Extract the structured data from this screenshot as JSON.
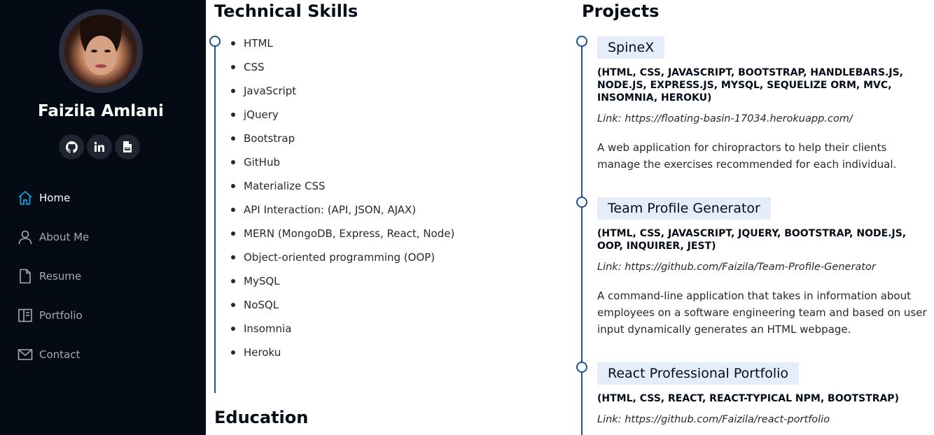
{
  "profile": {
    "name": "Faizila Amlani",
    "social": [
      {
        "icon": "github-icon"
      },
      {
        "icon": "linkedin-icon"
      },
      {
        "icon": "resume-file-icon"
      }
    ]
  },
  "nav": {
    "items": [
      {
        "label": "Home",
        "icon": "home-icon",
        "active": true
      },
      {
        "label": "About Me",
        "icon": "person-icon",
        "active": false
      },
      {
        "label": "Resume",
        "icon": "file-icon",
        "active": false
      },
      {
        "label": "Portfolio",
        "icon": "book-icon",
        "active": false
      },
      {
        "label": "Contact",
        "icon": "envelope-icon",
        "active": false
      }
    ]
  },
  "colors": {
    "sidebar_bg": "#040b14",
    "accent": "#1f5297",
    "active_icon": "#149ddd",
    "project_title_bg": "#e4edf9"
  },
  "skills": {
    "title": "Technical Skills",
    "items": [
      "HTML",
      "CSS",
      "JavaScript",
      "jQuery",
      "Bootstrap",
      "GitHub",
      "Materialize CSS",
      "API Interaction: (API, JSON, AJAX)",
      "MERN (MongoDB, Express, React, Node)",
      "Object-oriented programming (OOP)",
      "MySQL",
      "NoSQL",
      "Insomnia",
      "Heroku"
    ]
  },
  "education": {
    "title": "Education"
  },
  "projects": {
    "title": "Projects",
    "items": [
      {
        "name": "SpineX",
        "tech": "(HTML, CSS, JAVASCRIPT, BOOTSTRAP, HANDLEBARS.JS, NODE.JS, EXPRESS.JS, MYSQL, SEQUELIZE ORM, MVC, INSOMNIA, HEROKU)",
        "link": "Link: https://floating-basin-17034.herokuapp.com/",
        "description": "A web application for chiropractors to help their clients manage the exercises recommended for each individual."
      },
      {
        "name": "Team Profile Generator",
        "tech": "(HTML, CSS, JAVASCRIPT, JQUERY, BOOTSTRAP, NODE.JS, OOP, INQUIRER, JEST)",
        "link": "Link: https://github.com/Faizila/Team-Profile-Generator",
        "description": "A command-line application that takes in information about employees on a software engineering team and based on user input dynamically generates an HTML webpage."
      },
      {
        "name": "React Professional Portfolio",
        "tech": "(HTML, CSS, REACT, REACT-TYPICAL NPM, BOOTSTRAP)",
        "link": "Link: https://github.com/Faizila/react-portfolio"
      }
    ]
  }
}
